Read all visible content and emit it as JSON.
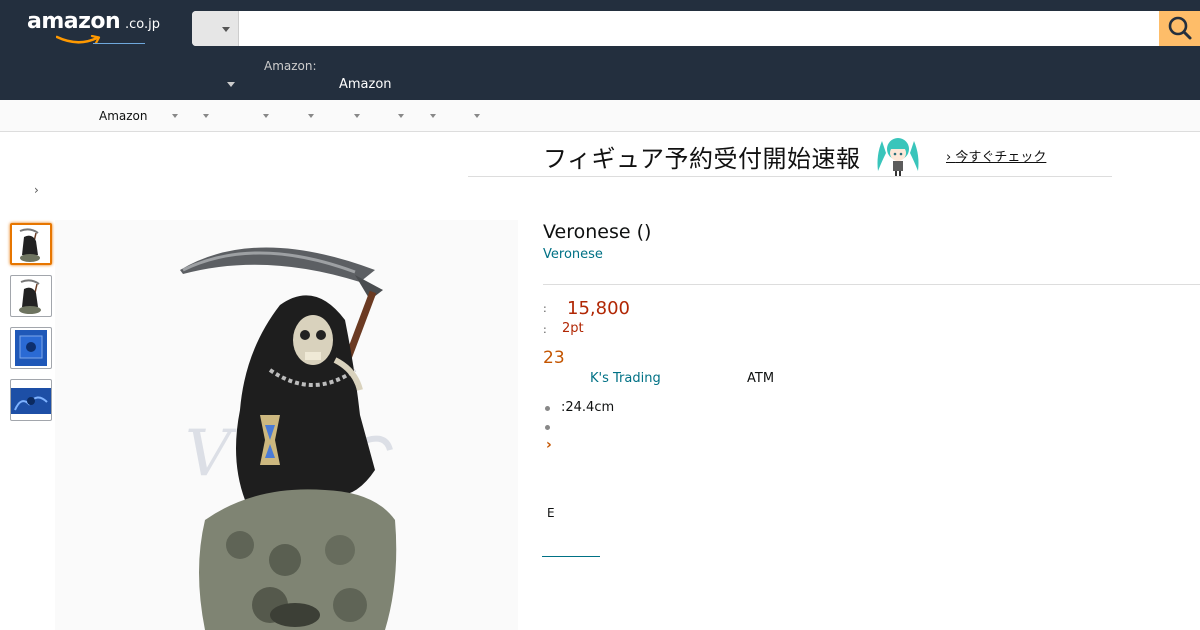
{
  "header": {
    "logo_text": "amazon",
    "logo_tld": ".co.jp",
    "search": {
      "placeholder": "",
      "value": ""
    },
    "sub_nav": {
      "label_small": "Amazon:",
      "label_main": "Amazon"
    }
  },
  "category_nav": {
    "label": "Amazon",
    "dropdown_count": 8
  },
  "banner": {
    "title": "フィギュア予約受付開始速報",
    "link": "今すぐチェック"
  },
  "breadcrumb": {
    "separator": "›"
  },
  "thumbnails": [
    {
      "name": "reaper-front",
      "selected": true
    },
    {
      "name": "reaper-angle",
      "selected": false
    },
    {
      "name": "blue-box",
      "selected": false
    },
    {
      "name": "blue-label",
      "selected": false
    }
  ],
  "product": {
    "title": "Veronese ()",
    "brand": "Veronese",
    "price_label": ":",
    "price": "15,800",
    "points_label": ":",
    "points": "2pt",
    "stock": "23",
    "seller": "K's Trading",
    "payment": "ATM",
    "bullets": [
      ":24.4cm",
      ""
    ],
    "more_link": "›",
    "e_label": "E"
  },
  "colors": {
    "header_bg": "#232f3e",
    "search_button": "#febd69",
    "price": "#b12704",
    "link": "#007185",
    "accent_orange": "#c45500"
  }
}
